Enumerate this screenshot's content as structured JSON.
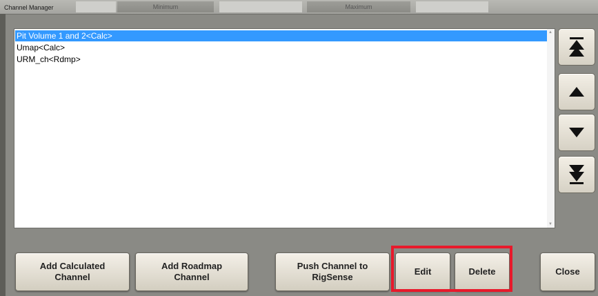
{
  "window": {
    "title": "Channel Manager"
  },
  "header": {
    "minimum_label": "Minimum",
    "maximum_label": "Maximum"
  },
  "channel_list": {
    "items": [
      {
        "label": "Pit Volume 1 and 2<Calc>",
        "selected": true
      },
      {
        "label": "Umap<Calc>",
        "selected": false
      },
      {
        "label": "URM_ch<Rdmp>",
        "selected": false
      }
    ]
  },
  "nav_buttons": {
    "icons": [
      "double-up-arrow-icon",
      "up-arrow-icon",
      "down-arrow-icon",
      "double-down-arrow-icon"
    ]
  },
  "actions": {
    "add_calculated_line1": "Add Calculated",
    "add_calculated_line2": "Channel",
    "add_roadmap_line1": "Add Roadmap",
    "add_roadmap_line2": "Channel",
    "push_line1": "Push Channel to",
    "push_line2": "RigSense",
    "edit": "Edit",
    "delete": "Delete",
    "close": "Close"
  },
  "colors": {
    "selection": "#3399ff",
    "highlight_box": "#e8192b",
    "background": "#8a8a85"
  }
}
